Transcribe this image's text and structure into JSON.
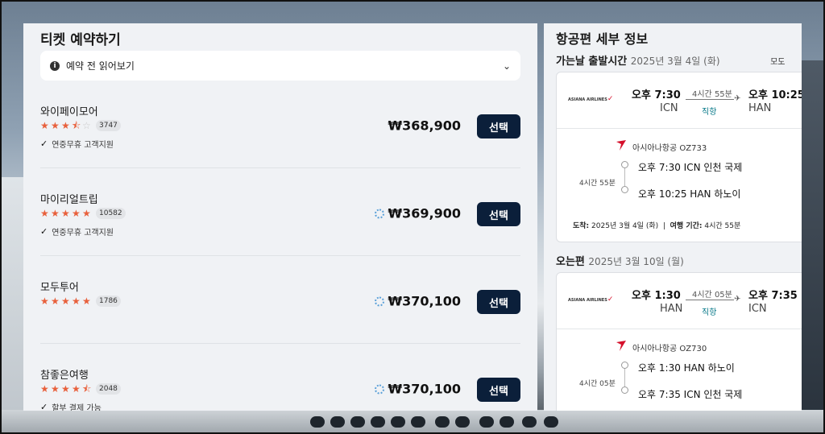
{
  "booking": {
    "title": "티켓 예약하기",
    "notice_label": "예약 전 읽어보기",
    "select_label": "선택",
    "providers": [
      {
        "name": "와이페이모어",
        "rating": 3.5,
        "review_count": "3747",
        "feature": "연중무휴 고객지원",
        "price": "₩368,900",
        "loading": false
      },
      {
        "name": "마이리얼트립",
        "rating": 5,
        "review_count": "10582",
        "feature": "연중무휴 고객지원",
        "price": "₩369,900",
        "loading": true
      },
      {
        "name": "모두투어",
        "rating": 5,
        "review_count": "1786",
        "feature": "",
        "price": "₩370,100",
        "loading": true
      },
      {
        "name": "참좋은여행",
        "rating": 4.5,
        "review_count": "2048",
        "feature": "할부 결제 가능",
        "price": "₩370,100",
        "loading": true
      }
    ]
  },
  "details": {
    "title": "항공편 세부 정보",
    "outbound": {
      "label": "가는날 출발시간",
      "date": "2025년 3월 4일 (화)",
      "cut_text": "모도",
      "airline_logo": "ASIANA AIRLINES",
      "dep_time": "오후 7:30",
      "dep_code": "ICN",
      "duration": "4시간 55분",
      "direct": "직항",
      "arr_time": "오후 10:25",
      "arr_code": "HAN",
      "carrier_flight": "아시아나항공 OZ733",
      "seg_duration": "4시간 55분",
      "seg_dep": "오후 7:30 ICN 인천 국제",
      "seg_arr": "오후 10:25 HAN 하노이",
      "arrival_label": "도착:",
      "arrival_date": "2025년 3월 4일 (화)",
      "separator": "|",
      "travel_label": "여행 기간:",
      "travel_time": "4시간 55분"
    },
    "inbound": {
      "label": "오는편",
      "date": "2025년 3월 10일 (월)",
      "airline_logo": "ASIANA AIRLINES",
      "dep_time": "오후 1:30",
      "dep_code": "HAN",
      "duration": "4시간 05분",
      "direct": "직항",
      "arr_time": "오후 7:35",
      "arr_code": "ICN",
      "carrier_flight": "아시아나항공 OZ730",
      "seg_duration": "4시간 05분",
      "seg_dep": "오후 1:30 HAN 하노이",
      "seg_arr": "오후 7:35 ICN 인천 국제"
    }
  },
  "colors": {
    "star": "#e8603c",
    "button": "#0b1f3a",
    "brand_red": "#d5102b",
    "direct": "#0a7a8a"
  },
  "icons": {
    "notice": "info-icon",
    "expand": "chevron-down-icon",
    "check": "check-icon",
    "loading": "spinner-icon",
    "plane": "airplane-icon"
  }
}
